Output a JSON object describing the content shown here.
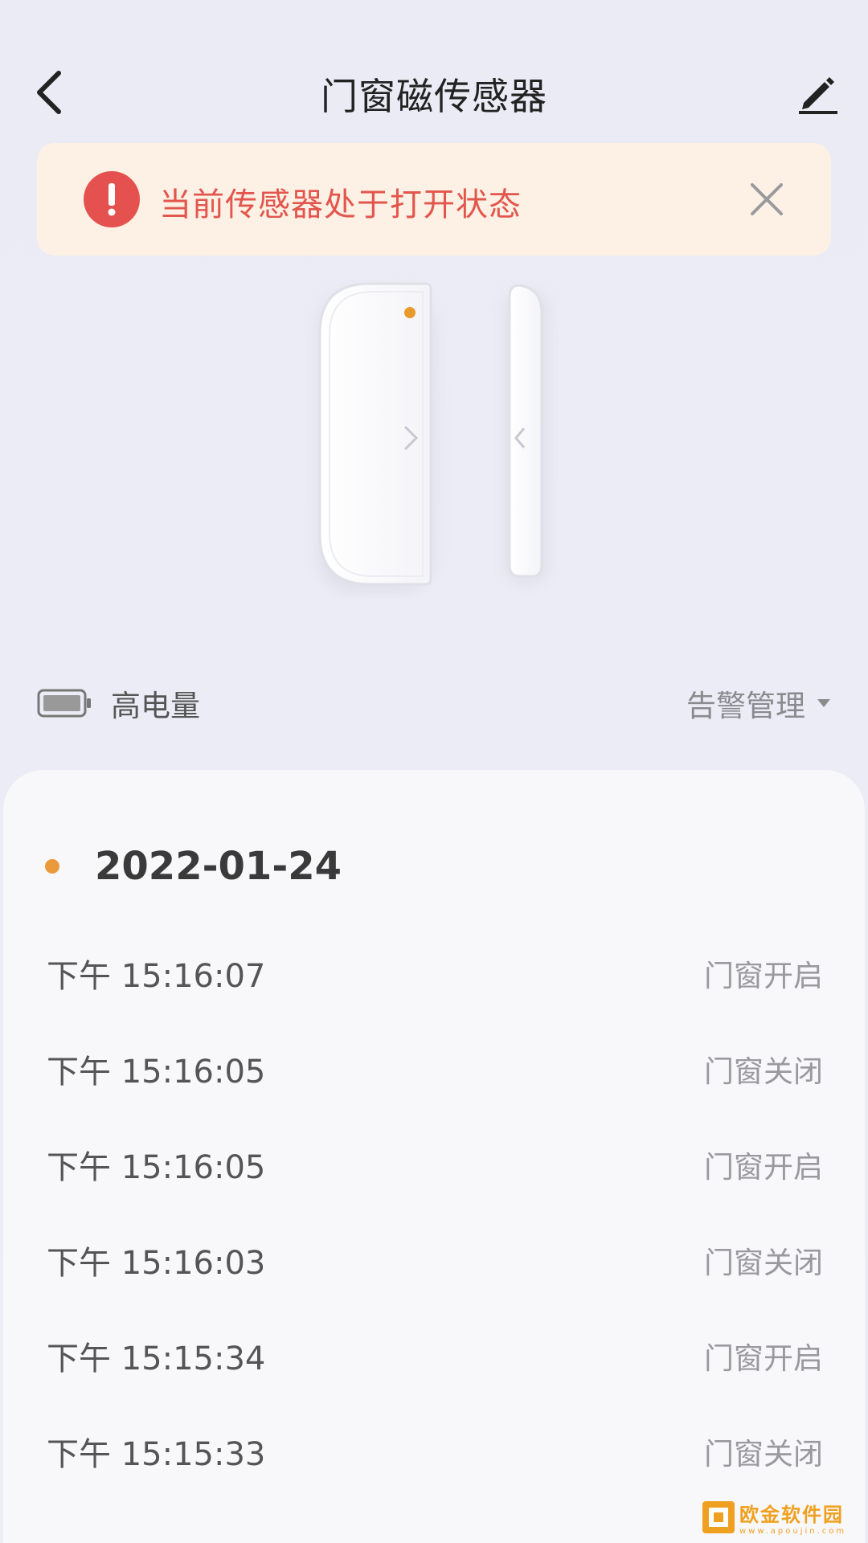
{
  "header": {
    "title": "门窗磁传感器",
    "back_icon": "chevron-left-icon",
    "edit_icon": "pencil-icon"
  },
  "alert": {
    "message": "当前传感器处于打开状态",
    "icon": "exclamation-circle-icon",
    "close_icon": "close-icon",
    "color": "#e5514f",
    "background": "#fcf1e4"
  },
  "status": {
    "battery_label": "高电量",
    "battery_icon": "battery-icon",
    "alarm_management_label": "告警管理",
    "dropdown_icon": "caret-down-icon"
  },
  "records": {
    "date": "2022-01-24",
    "date_dot_color": "#eb9a3b",
    "events": [
      {
        "period": "下午",
        "time": "15:16:07",
        "status": "门窗开启"
      },
      {
        "period": "下午",
        "time": "15:16:05",
        "status": "门窗关闭"
      },
      {
        "period": "下午",
        "time": "15:16:05",
        "status": "门窗开启"
      },
      {
        "period": "下午",
        "time": "15:16:03",
        "status": "门窗关闭"
      },
      {
        "period": "下午",
        "time": "15:15:34",
        "status": "门窗开启"
      },
      {
        "period": "下午",
        "time": "15:15:33",
        "status": "门窗关闭"
      }
    ]
  },
  "watermark": {
    "main_text": "欧金软件园",
    "sub_text": "www.apoujin.com"
  }
}
